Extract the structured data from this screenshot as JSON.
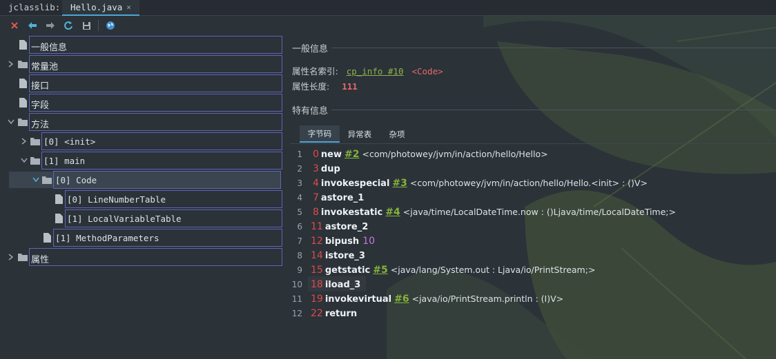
{
  "app": {
    "title": "jclasslib:",
    "tab_label": "Hello.java",
    "tab_close": "×"
  },
  "toolbar": {
    "buttons": [
      "close-icon",
      "back-icon",
      "forward-icon",
      "refresh-icon",
      "save-icon",
      "web-icon"
    ]
  },
  "tree": {
    "general": "一般信息",
    "constant_pool": "常量池",
    "interfaces": "接口",
    "fields": "字段",
    "methods": "方法",
    "init": "[0] <init>",
    "main": "[1] main",
    "code": "[0] Code",
    "line_number_table": "[0] LineNumberTable",
    "local_variable_table": "[1] LocalVariableTable",
    "method_parameters": "[1] MethodParameters",
    "attributes": "属性"
  },
  "panel": {
    "general_header": "一般信息",
    "name_index_label": "属性名索引:",
    "name_index_link": "cp_info #10",
    "name_index_value": "<Code>",
    "length_label": "属性长度:",
    "length_value": "111",
    "specific_header": "特有信息",
    "tabs": [
      "字节码",
      "异常表",
      "杂项"
    ],
    "active_tab": "字节码"
  },
  "bytecode": [
    {
      "line": "1",
      "offset": "0",
      "op": "new",
      "ref": "#2",
      "comment": "<com/photowey/jvm/in/action/hello/Hello>"
    },
    {
      "line": "2",
      "offset": "3",
      "op": "dup"
    },
    {
      "line": "3",
      "offset": "4",
      "op": "invokespecial",
      "ref": "#3",
      "comment": "<com/photowey/jvm/in/action/hello/Hello.<init> : ()V>"
    },
    {
      "line": "4",
      "offset": "7",
      "op": "astore_1"
    },
    {
      "line": "5",
      "offset": "8",
      "op": "invokestatic",
      "ref": "#4",
      "comment": "<java/time/LocalDateTime.now : ()Ljava/time/LocalDateTime;>"
    },
    {
      "line": "6",
      "offset": "11",
      "op": "astore_2"
    },
    {
      "line": "7",
      "offset": "12",
      "op": "bipush",
      "imm": "10"
    },
    {
      "line": "8",
      "offset": "14",
      "op": "istore_3"
    },
    {
      "line": "9",
      "offset": "15",
      "op": "getstatic",
      "ref": "#5",
      "comment": "<java/lang/System.out : Ljava/io/PrintStream;>"
    },
    {
      "line": "10",
      "offset": "18",
      "op": "iload_3"
    },
    {
      "line": "11",
      "offset": "19",
      "op": "invokevirtual",
      "ref": "#6",
      "comment": "<java/io/PrintStream.println : (I)V>"
    },
    {
      "line": "12",
      "offset": "22",
      "op": "return"
    }
  ],
  "colors": {
    "accent": "#4ea6d6",
    "tree_border": "#5f66b8",
    "offset": "#e04a4a",
    "reference": "#86b33a",
    "immediate": "#c678dd"
  }
}
